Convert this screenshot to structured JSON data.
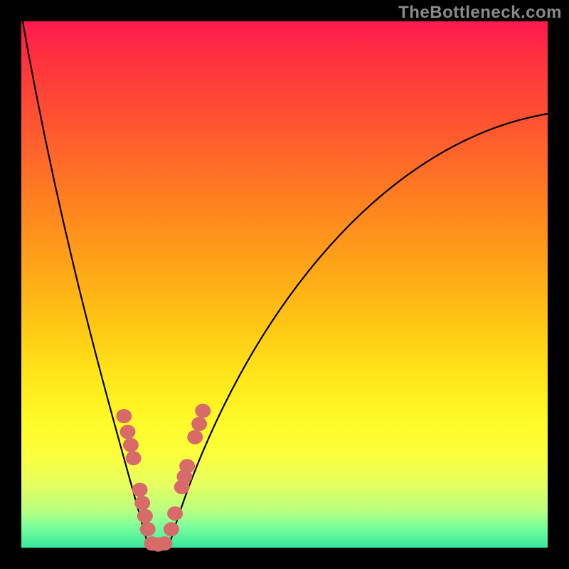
{
  "watermark": "TheBottleneck.com",
  "chart_data": {
    "type": "line",
    "title": "",
    "xlabel": "",
    "ylabel": "",
    "xlim": [
      0,
      100
    ],
    "ylim": [
      0,
      100
    ],
    "grid": false,
    "curve_left": {
      "end_x": 0,
      "end_y": 100,
      "start_x": 25,
      "start_y": 0
    },
    "curve_right": {
      "start_x": 27,
      "start_y": 0,
      "end_x": 100,
      "end_y": 82
    },
    "flat_bottom": {
      "x_start": 24,
      "x_end": 28,
      "y": 0.5
    },
    "series": [
      {
        "name": "left-branch-points",
        "values": [
          {
            "x": 19.5,
            "y": 25
          },
          {
            "x": 20.2,
            "y": 22
          },
          {
            "x": 20.8,
            "y": 19.5
          },
          {
            "x": 21.3,
            "y": 17
          },
          {
            "x": 22.5,
            "y": 11
          },
          {
            "x": 23.0,
            "y": 8.5
          },
          {
            "x": 23.5,
            "y": 6
          },
          {
            "x": 24.0,
            "y": 3.5
          }
        ]
      },
      {
        "name": "bottom-points",
        "values": [
          {
            "x": 24.8,
            "y": 0.8
          },
          {
            "x": 26.0,
            "y": 0.6
          },
          {
            "x": 27.2,
            "y": 0.8
          }
        ]
      },
      {
        "name": "right-branch-points",
        "values": [
          {
            "x": 28.5,
            "y": 3.5
          },
          {
            "x": 29.2,
            "y": 6.5
          },
          {
            "x": 30.5,
            "y": 11.5
          },
          {
            "x": 31.0,
            "y": 13.5
          },
          {
            "x": 31.5,
            "y": 15.5
          },
          {
            "x": 33.0,
            "y": 21
          },
          {
            "x": 33.8,
            "y": 23.5
          },
          {
            "x": 34.5,
            "y": 26
          }
        ]
      }
    ]
  }
}
